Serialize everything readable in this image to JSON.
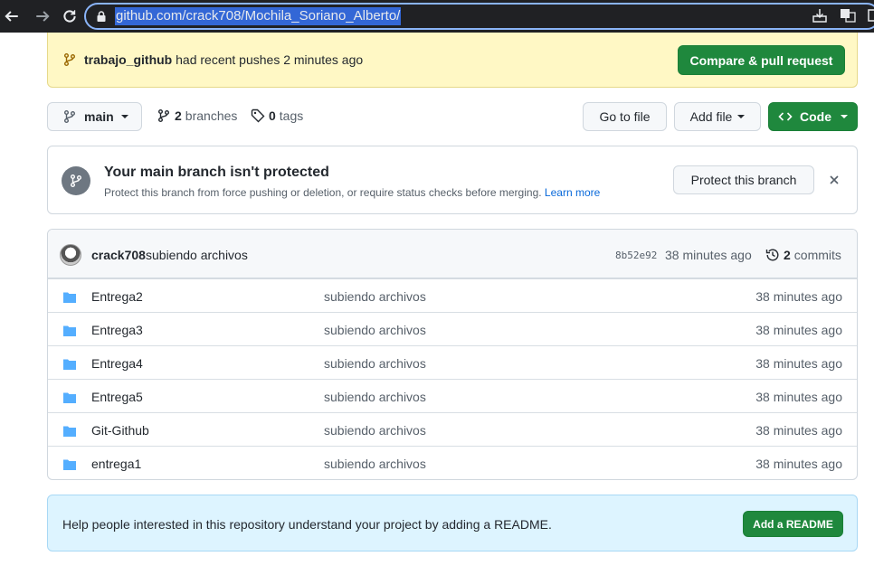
{
  "browser": {
    "url": "github.com/crack708/Mochila_Soriano_Alberto/",
    "back_icon": "arrow-left-icon",
    "forward_icon": "arrow-right-icon",
    "reload_icon": "reload-icon"
  },
  "push_banner": {
    "branch": "trabajo_github",
    "text": "had recent pushes 2 minutes ago",
    "button": "Compare & pull request"
  },
  "toolbar": {
    "branch_button": "main",
    "branches_count": "2",
    "branches_label": "branches",
    "tags_count": "0",
    "tags_label": "tags",
    "goto_file": "Go to file",
    "add_file": "Add file",
    "code": "Code"
  },
  "protect": {
    "title": "Your main branch isn't protected",
    "description": "Protect this branch from force pushing or deletion, or require status checks before merging.",
    "learn_more": "Learn more",
    "button": "Protect this branch"
  },
  "commit": {
    "author": "crack708",
    "message": "subiendo archivos",
    "sha": "8b52e92",
    "time": "38 minutes ago",
    "commits_count": "2",
    "commits_label": "commits"
  },
  "files": [
    {
      "name": "Entrega2",
      "message": "subiendo archivos",
      "time": "38 minutes ago"
    },
    {
      "name": "Entrega3",
      "message": "subiendo archivos",
      "time": "38 minutes ago"
    },
    {
      "name": "Entrega4",
      "message": "subiendo archivos",
      "time": "38 minutes ago"
    },
    {
      "name": "Entrega5",
      "message": "subiendo archivos",
      "time": "38 minutes ago"
    },
    {
      "name": "Git-Github",
      "message": "subiendo archivos",
      "time": "38 minutes ago"
    },
    {
      "name": "entrega1",
      "message": "subiendo archivos",
      "time": "38 minutes ago"
    }
  ],
  "readme": {
    "text": "Help people interested in this repository understand your project by adding a README.",
    "button": "Add a README"
  },
  "colors": {
    "green": "#1f883d",
    "folder": "#54aeff",
    "link": "#0969da",
    "banner_yellow": "#fff8c5",
    "banner_blue": "#ddf4ff"
  }
}
